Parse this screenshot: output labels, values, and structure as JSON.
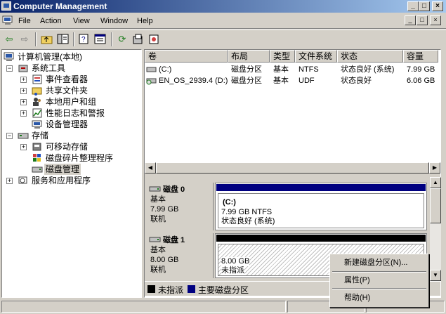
{
  "window": {
    "title": "Computer Management",
    "caption_buttons": [
      "_",
      "□",
      "×"
    ]
  },
  "menu": {
    "items": [
      "File",
      "Action",
      "View",
      "Window",
      "Help"
    ],
    "mdi_buttons": [
      "_",
      "□",
      "×"
    ]
  },
  "toolbar": {
    "icons": [
      "back-icon",
      "forward-icon",
      "up-folder-icon",
      "show-hide-tree-icon",
      "properties-icon",
      "help-icon",
      "refresh-icon",
      "export-icon",
      "disk-settings-icon"
    ]
  },
  "tree": {
    "items": [
      {
        "label": "计算机管理(本地)",
        "icon": "computer-icon"
      },
      {
        "label": "系统工具",
        "icon": "tools-icon"
      },
      {
        "label": "事件查看器",
        "icon": "event-viewer-icon"
      },
      {
        "label": "共享文件夹",
        "icon": "shared-folder-icon"
      },
      {
        "label": "本地用户和组",
        "icon": "users-icon"
      },
      {
        "label": "性能日志和警报",
        "icon": "performance-icon"
      },
      {
        "label": "设备管理器",
        "icon": "device-manager-icon"
      },
      {
        "label": "存储",
        "icon": "storage-icon"
      },
      {
        "label": "可移动存储",
        "icon": "removable-storage-icon"
      },
      {
        "label": "磁盘碎片整理程序",
        "icon": "defrag-icon"
      },
      {
        "label": "磁盘管理",
        "icon": "disk-management-icon"
      },
      {
        "label": "服务和应用程序",
        "icon": "services-icon"
      }
    ]
  },
  "volumes": {
    "headers": [
      "卷",
      "布局",
      "类型",
      "文件系统",
      "状态",
      "容量"
    ],
    "rows": [
      {
        "name": "(C:)",
        "layout": "磁盘分区",
        "type": "基本",
        "fs": "NTFS",
        "status": "状态良好 (系统)",
        "capacity": "7.99 GB"
      },
      {
        "name": "EN_OS_2939.4 (D:)",
        "layout": "磁盘分区",
        "type": "基本",
        "fs": "UDF",
        "status": "状态良好",
        "capacity": "6.06 GB"
      }
    ]
  },
  "disks": [
    {
      "name": "磁盘 0",
      "type": "基本",
      "size": "7.99 GB",
      "state": "联机",
      "partition": {
        "name": "(C:)",
        "size_fs": "7.99 GB NTFS",
        "status": "状态良好 (系统)"
      }
    },
    {
      "name": "磁盘 1",
      "type": "基本",
      "size": "8.00 GB",
      "state": "联机",
      "partition": {
        "size": "8.00 GB",
        "status": "未指派"
      }
    }
  ],
  "legend": {
    "items": [
      {
        "label": "未指派",
        "color": "#000000"
      },
      {
        "label": "主要磁盘分区",
        "color": "#000080"
      }
    ]
  },
  "context_menu": {
    "items": [
      "新建磁盘分区(N)...",
      "属性(P)",
      "帮助(H)"
    ]
  },
  "colors": {
    "titlebar_start": "#0a246a",
    "titlebar_end": "#a6caf0",
    "primary_partition": "#000080",
    "unallocated": "#000000"
  }
}
